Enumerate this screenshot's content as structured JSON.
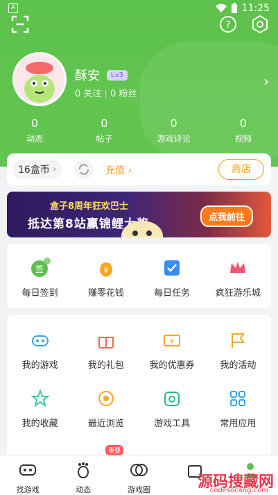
{
  "status_bar": {
    "time": "11:25",
    "left_badge": "A"
  },
  "profile": {
    "username": "酥安",
    "level": "Lv3",
    "following": "0 关注",
    "followers": "0 粉丝"
  },
  "stats": [
    {
      "value": "0",
      "label": "动态"
    },
    {
      "value": "0",
      "label": "帖子"
    },
    {
      "value": "0",
      "label": "游戏评论"
    },
    {
      "value": "0",
      "label": "视频"
    }
  ],
  "coins": {
    "balance": "16盒币",
    "recharge": "充值",
    "shop": "商店"
  },
  "banner": {
    "line1": "盒子8周年狂欢巴士",
    "line2": "抵达第8站赢锦鲤大奖",
    "button": "点我前往"
  },
  "quick_actions": [
    {
      "label": "每日签到",
      "icon": "checkin-icon",
      "badge": "+6"
    },
    {
      "label": "赚零花钱",
      "icon": "money-bag-icon"
    },
    {
      "label": "每日任务",
      "icon": "task-icon"
    },
    {
      "label": "疯狂游乐城",
      "icon": "crown-icon"
    }
  ],
  "tools_row1": [
    {
      "label": "我的游戏",
      "icon": "gamepad-icon"
    },
    {
      "label": "我的礼包",
      "icon": "gift-icon"
    },
    {
      "label": "我的优惠券",
      "icon": "coupon-icon",
      "badge": "1"
    },
    {
      "label": "我的活动",
      "icon": "flag-icon"
    }
  ],
  "tools_row2": [
    {
      "label": "我的收藏",
      "icon": "star-icon"
    },
    {
      "label": "最近浏览",
      "icon": "eye-icon"
    },
    {
      "label": "游戏工具",
      "icon": "toolbox-icon"
    },
    {
      "label": "常用应用",
      "icon": "apps-icon"
    }
  ],
  "hot_badge": "重要",
  "tabbar": [
    {
      "label": "找游戏",
      "icon": "game-tab-icon"
    },
    {
      "label": "动态",
      "icon": "footprint-tab-icon"
    },
    {
      "label": "游戏圈",
      "icon": "circle-tab-icon"
    },
    {
      "label": "",
      "icon": "shop-tab-icon"
    },
    {
      "label": "",
      "icon": "me-tab-icon"
    }
  ],
  "watermark": {
    "main": "源码搜藏网",
    "sub": "codesocang.com"
  },
  "colors": {
    "brand_green": "#5dc24c",
    "accent_orange": "#f39c12",
    "level_purple": "#6b5dd3"
  }
}
